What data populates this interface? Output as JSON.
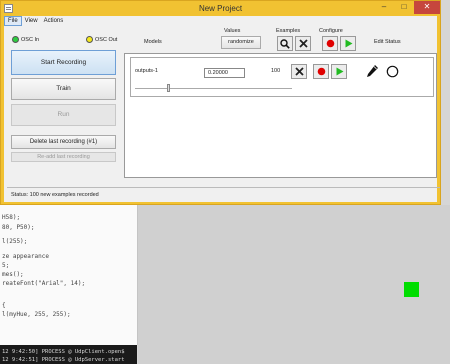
{
  "window": {
    "title": "New Project"
  },
  "menu": [
    "File",
    "View",
    "Actions"
  ],
  "osc": {
    "in_label": "OSC In",
    "in_color": "#2ecc40",
    "out_label": "OSC Out",
    "out_color": "#f4e81c"
  },
  "left": {
    "start_recording": "Start Recording",
    "train": "Train",
    "run": "Run",
    "delete_last": "Delete last recording (#1)",
    "readd_last": "Re-add last recording"
  },
  "headers": {
    "models": "Models",
    "values": "Values",
    "randomize": "randomize",
    "examples": "Examples",
    "configure": "Configure",
    "edit_status": "Edit  Status"
  },
  "model_row": {
    "name": "outputs-1",
    "value": "0.20000",
    "examples": "100"
  },
  "status": "Status:  100 new examples recorded",
  "code_lines": [
    {
      "text": "H58);"
    },
    {
      "text": "80, P50);"
    },
    {
      "text": ""
    },
    {
      "text": "l(255);"
    },
    {
      "text": ""
    },
    {
      "text": "ze appearance"
    },
    {
      "text": "5;"
    },
    {
      "text": "mes();"
    },
    {
      "text": "reateFont(\"Arial\", 14);"
    },
    {
      "text": ""
    },
    {
      "text": ""
    },
    {
      "text": "{"
    },
    {
      "text": "l(myHue, 255, 255);"
    },
    {
      "text": ""
    },
    {
      "text": ""
    }
  ],
  "console": [
    "12 9:42:50] PROCESS @ UdpClient.open$",
    "12 9:42:51] PROCESS @ UdpServer.start"
  ],
  "colors": {
    "record": "#e00000",
    "play": "#22bb22",
    "accent": "#f1c232",
    "sketch_square": "#00dd00"
  }
}
